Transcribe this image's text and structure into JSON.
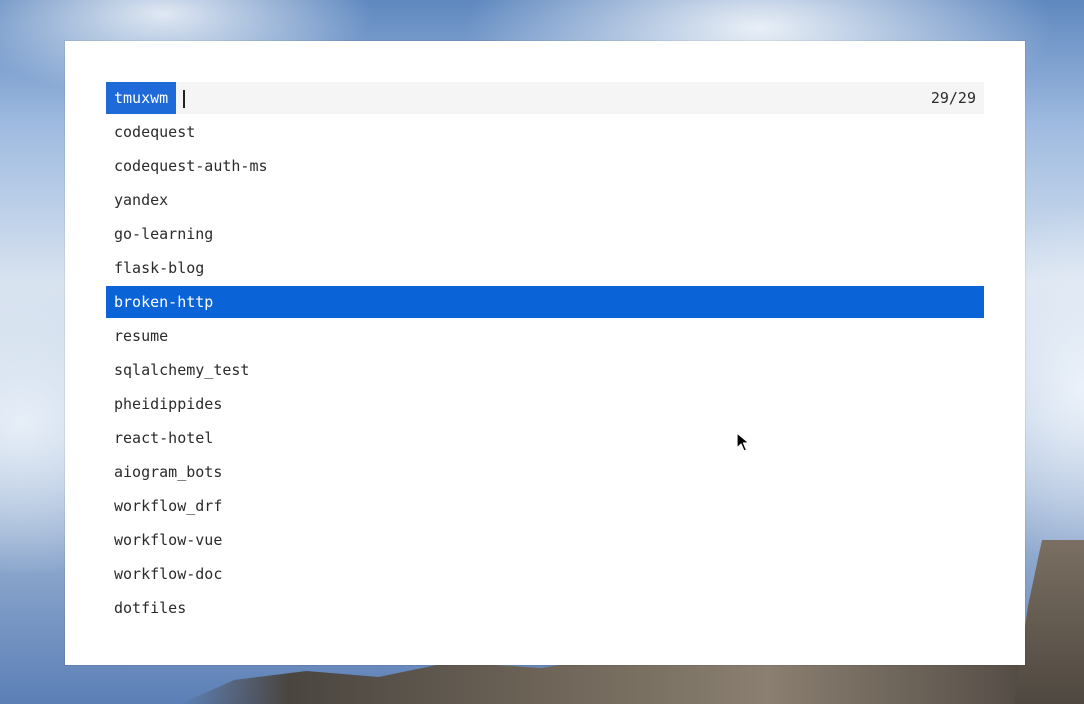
{
  "prompt": {
    "label": "tmuxwm",
    "input_value": "",
    "counter": "29/29"
  },
  "items": [
    {
      "label": "codequest",
      "selected": false
    },
    {
      "label": "codequest-auth-ms",
      "selected": false
    },
    {
      "label": "yandex",
      "selected": false
    },
    {
      "label": "go-learning",
      "selected": false
    },
    {
      "label": "flask-blog",
      "selected": false
    },
    {
      "label": "broken-http",
      "selected": true
    },
    {
      "label": "resume",
      "selected": false
    },
    {
      "label": "sqlalchemy_test",
      "selected": false
    },
    {
      "label": "pheidippides",
      "selected": false
    },
    {
      "label": "react-hotel",
      "selected": false
    },
    {
      "label": "aiogram_bots",
      "selected": false
    },
    {
      "label": "workflow_drf",
      "selected": false
    },
    {
      "label": "workflow-vue",
      "selected": false
    },
    {
      "label": "workflow-doc",
      "selected": false
    },
    {
      "label": "dotfiles",
      "selected": false
    }
  ],
  "colors": {
    "selection": "#0b63d8",
    "prompt_label_bg": "#1e6ad8",
    "prompt_bar_bg": "#f5f5f5",
    "text": "#2b2b2b"
  },
  "icons": {
    "cursor": "mouse-pointer-icon"
  }
}
